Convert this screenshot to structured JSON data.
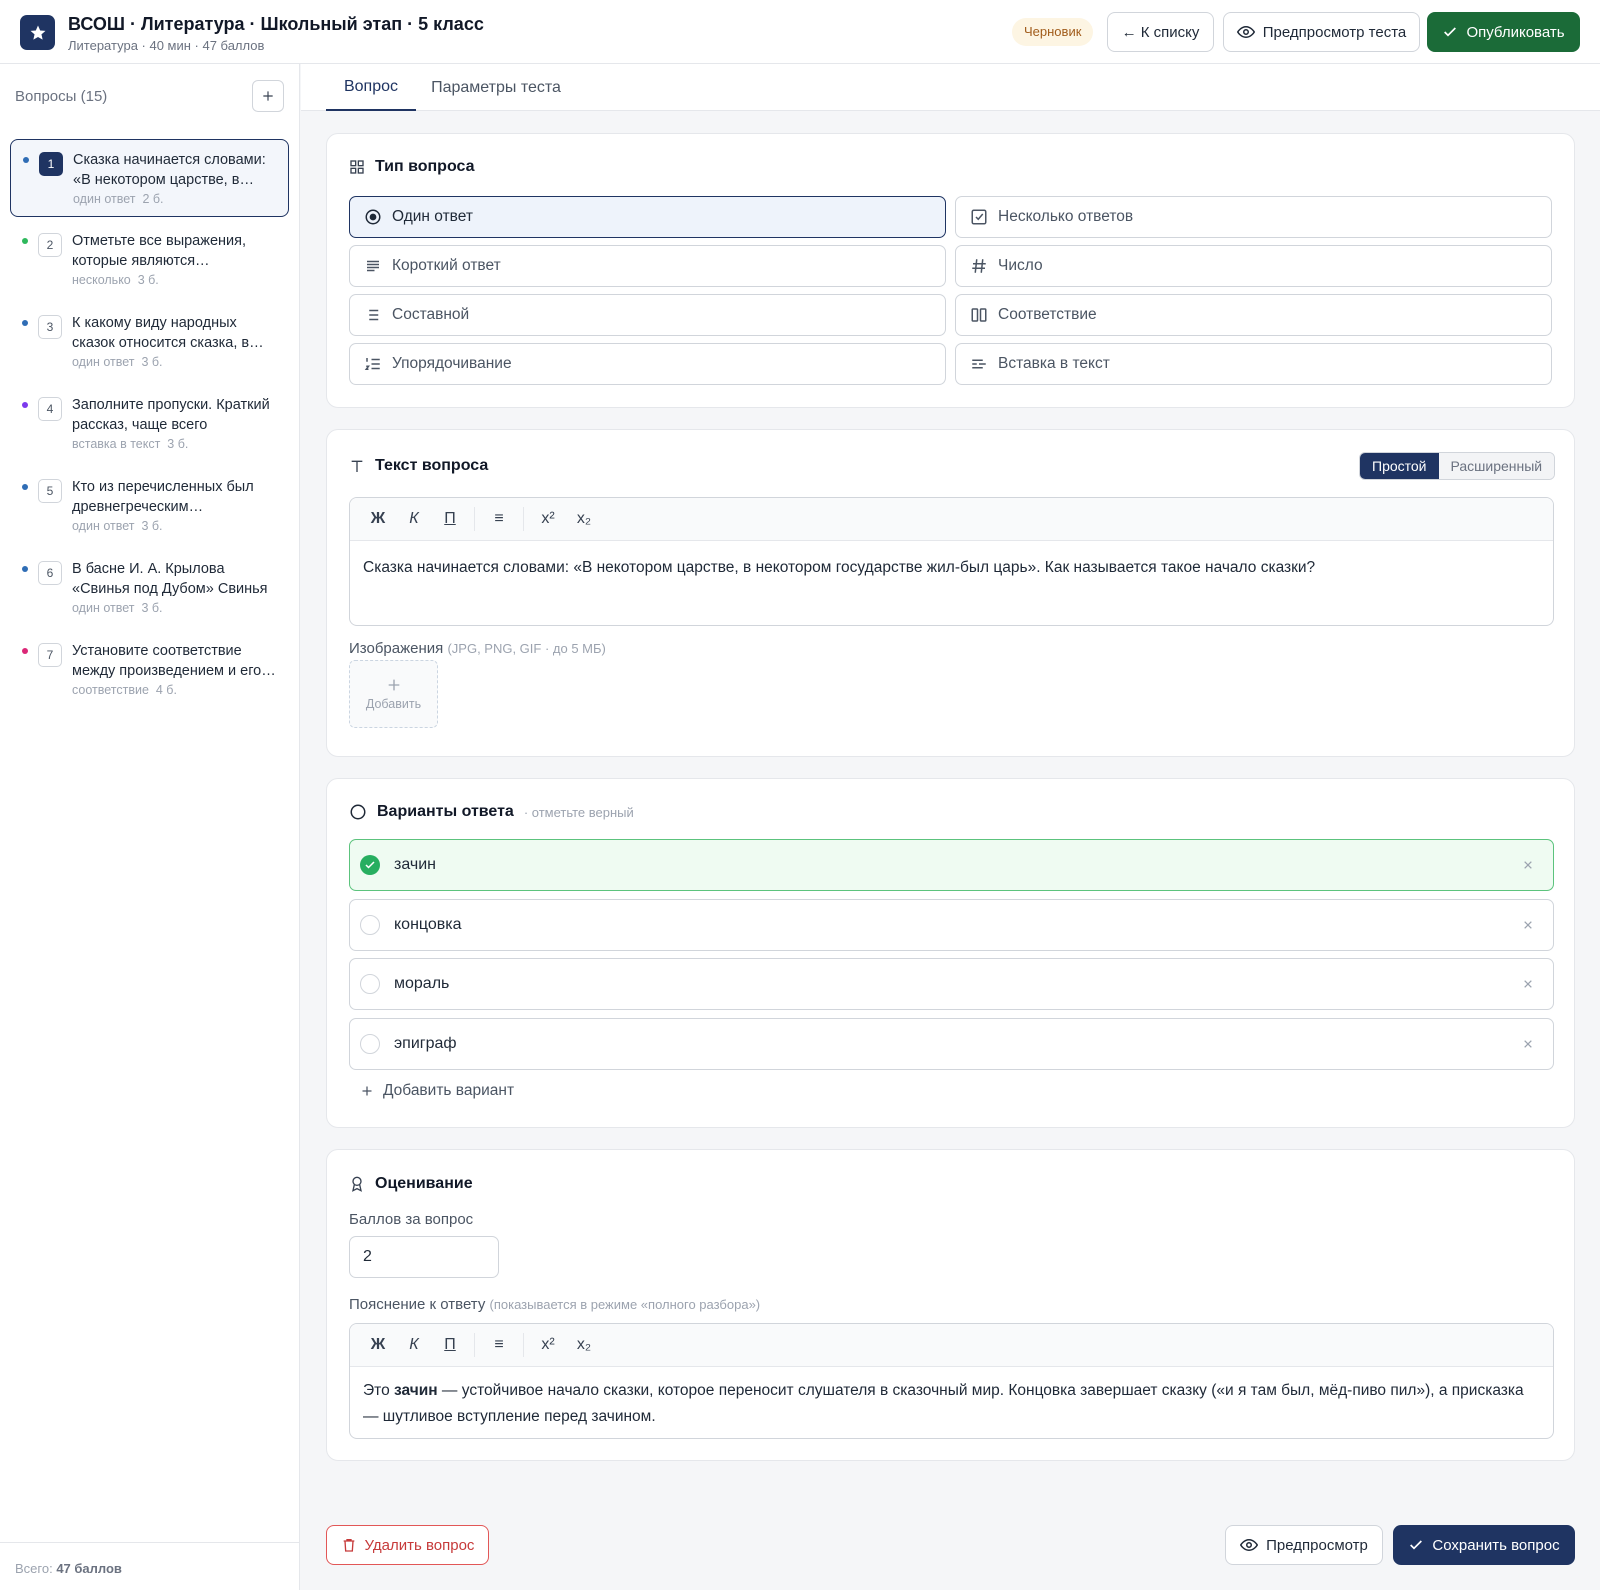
{
  "header": {
    "title": "ВСОШ · Литература · Школьный этап · 5 класс",
    "subtitle": "Литература · 40 мин · 47 баллов",
    "status_badge": "Черновик",
    "back_label": "← К списку",
    "preview_label": "Предпросмотр теста",
    "publish_label": "Опубликовать"
  },
  "sidebar": {
    "header": "Вопросы (15)",
    "items": [
      {
        "num": "1",
        "text": "Сказка начинается словами: «В некотором царстве, в некотором государстве жил-был царь»",
        "type": "один ответ",
        "points": "2 б.",
        "dot_color": "#2f6db5"
      },
      {
        "num": "2",
        "text": "Отметьте все выражения, которые являются устойчивыми",
        "type": "несколько",
        "points": "3 б.",
        "dot_color": "#2eb85c"
      },
      {
        "num": "3",
        "text": "К какому виду народных сказок относится сказка, в которой",
        "type": "один ответ",
        "points": "3 б.",
        "dot_color": "#2f6db5"
      },
      {
        "num": "4",
        "text": "Заполните пропуски. Краткий рассказ, чаще всего",
        "type": "вставка в текст",
        "points": "3 б.",
        "dot_color": "#7c3aed"
      },
      {
        "num": "5",
        "text": "Кто из перечисленных был древнегреческим баснописцем",
        "type": "один ответ",
        "points": "3 б.",
        "dot_color": "#2f6db5"
      },
      {
        "num": "6",
        "text": "В басне И. А. Крылова «Свинья под Дубом» Свинья",
        "type": "один ответ",
        "points": "3 б.",
        "dot_color": "#2f6db5"
      },
      {
        "num": "7",
        "text": "Установите соответствие между произведением и его автором",
        "type": "соответствие",
        "points": "4 б.",
        "dot_color": "#db2777"
      }
    ],
    "footer_prefix": "Всего: ",
    "footer_total": "47 баллов"
  },
  "tabs": [
    "Вопрос",
    "Параметры теста"
  ],
  "question_type": {
    "title": "Тип вопроса",
    "options": [
      {
        "label": "Один ответ",
        "icon": "radio-icon"
      },
      {
        "label": "Несколько ответов",
        "icon": "checkbox-icon"
      },
      {
        "label": "Короткий ответ",
        "icon": "lines-icon"
      },
      {
        "label": "Число",
        "icon": "hash-icon"
      },
      {
        "label": "Составной",
        "icon": "list-icon"
      },
      {
        "label": "Соответствие",
        "icon": "columns-icon"
      },
      {
        "label": "Упорядочивание",
        "icon": "ordered-list-icon"
      },
      {
        "label": "Вставка в текст",
        "icon": "text-insert-icon"
      }
    ],
    "selected": "Один ответ"
  },
  "question_text": {
    "title": "Текст вопроса",
    "mode_simple": "Простой",
    "mode_advanced": "Расширенный",
    "toolbar": {
      "bold": "Ж",
      "italic": "К",
      "underline": "П",
      "list": "≡",
      "sup": "x²",
      "sub": "x₂"
    },
    "body": "Сказка начинается словами: «В некотором царстве, в некотором государстве жил-был царь». Как называется такое начало сказки?",
    "images_label": "Изображения",
    "images_hint": "(JPG, PNG, GIF · до 5 МБ)",
    "add_image_label": "Добавить"
  },
  "answers": {
    "title": "Варианты ответа",
    "hint": "· отметьте верный",
    "options": [
      {
        "text": "зачин",
        "correct": true
      },
      {
        "text": "концовка",
        "correct": false
      },
      {
        "text": "мораль",
        "correct": false
      },
      {
        "text": "эпиграф",
        "correct": false
      }
    ],
    "add_label": "Добавить вариант"
  },
  "grading": {
    "title": "Оценивание",
    "points_label": "Баллов за вопрос",
    "points_value": "2",
    "explanation_label": "Пояснение к ответу",
    "explanation_hint": "(показывается в режиме «полного разбора»)",
    "explanation_prefix": "Это ",
    "explanation_bold": "зачин",
    "explanation_rest": " — устойчивое начало сказки, которое переносит слушателя в сказочный мир. Концовка завершает сказку («и я там был, мёд-пиво пил»), а присказка — шутливое вступление перед зачином."
  },
  "footer": {
    "delete_label": "Удалить вопрос",
    "preview_label": "Предпросмотр",
    "save_label": "Сохранить вопрос"
  },
  "colors": {
    "brand": "#1f3462",
    "publish": "#1b6b38",
    "correct": "#27ae60",
    "danger": "#c63a3a"
  }
}
